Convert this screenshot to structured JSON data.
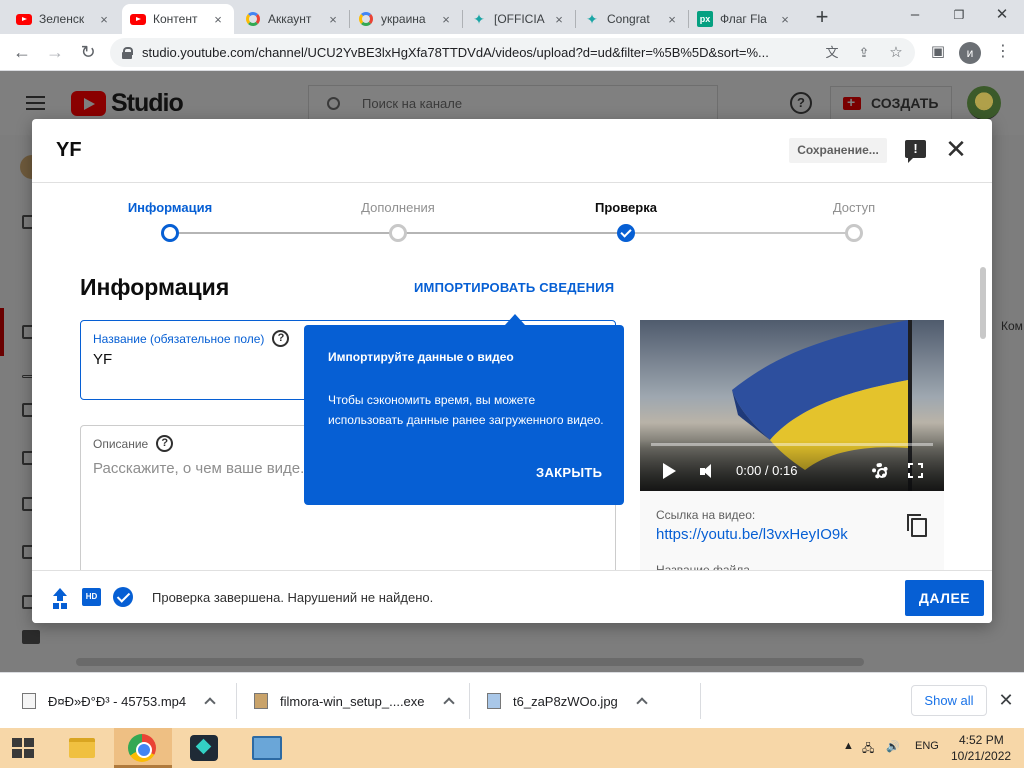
{
  "browser": {
    "tabs": [
      {
        "label": "Зеленск",
        "icon": "youtube-icon"
      },
      {
        "label": "Контент",
        "icon": "youtube-icon"
      },
      {
        "label": "Аккаунт",
        "icon": "google-icon"
      },
      {
        "label": "украина",
        "icon": "google-icon"
      },
      {
        "label": "[OFFICIA",
        "icon": "star-icon"
      },
      {
        "label": "Congrat",
        "icon": "star-icon"
      },
      {
        "label": "Флаг Fla",
        "icon": "px-icon"
      }
    ],
    "active_tab_index": 1,
    "tab_close_glyph": "×",
    "new_tab_glyph": "+",
    "url": "studio.youtube.com/channel/UCU2YvBE3lxHgXfa78TTDVdA/videos/upload?d=ud&filter=%5B%5D&sort=%...",
    "profile_initial": "и",
    "minimize_glyph": "–",
    "restore_glyph": "❐",
    "close_glyph": "✕"
  },
  "studio": {
    "logo_text": "Studio",
    "search_placeholder": "Поиск на канале",
    "help_glyph": "?",
    "create_label": "СОЗДАТЬ",
    "right_edge_text": "Ком"
  },
  "dialog": {
    "title": "YF",
    "saving_label": "Сохранение...",
    "feedback_glyph": "!",
    "close_glyph": "✕",
    "steps": [
      {
        "label": "Информация",
        "state": "active"
      },
      {
        "label": "Дополнения",
        "state": "pending"
      },
      {
        "label": "Проверка",
        "state": "checked"
      },
      {
        "label": "Доступ",
        "state": "pending"
      }
    ],
    "section_title": "Информация",
    "import_link": "ИМПОРТИРОВАТЬ СВЕДЕНИЯ",
    "title_field": {
      "label": "Название (обязательное поле)",
      "value": "YF"
    },
    "description_field": {
      "label": "Описание",
      "placeholder": "Расскажите, о чем ваше виде... автора, введите символ \"@\", а"
    },
    "help_glyph": "?",
    "preview": {
      "time": "0:00 / 0:16",
      "link_label": "Ссылка на видео:",
      "link_value": "https://youtu.be/l3vxHeyIO9k",
      "filename_label": "Название файла"
    },
    "popover": {
      "title": "Импортируйте данные о видео",
      "body": "Чтобы сэкономить время, вы можете использовать данные ранее загруженного видео.",
      "close_label": "ЗАКРЫТЬ"
    },
    "footer": {
      "hd_badge": "HD",
      "status": "Проверка завершена. Нарушений не найдено.",
      "next_label": "ДАЛЕЕ"
    }
  },
  "downloads": {
    "items": [
      {
        "name": "Ð¤Ð»Ð°Ð³ - 45753.mp4"
      },
      {
        "name": "filmora-win_setup_....exe"
      },
      {
        "name": "t6_zaP8zWOo.jpg"
      }
    ],
    "show_all_label": "Show all",
    "close_glyph": "✕"
  },
  "taskbar": {
    "lang": "ENG",
    "time": "4:52 PM",
    "date": "10/21/2022"
  },
  "colors": {
    "accent": "#065fd4",
    "taskbar": "#f7d7a8"
  }
}
